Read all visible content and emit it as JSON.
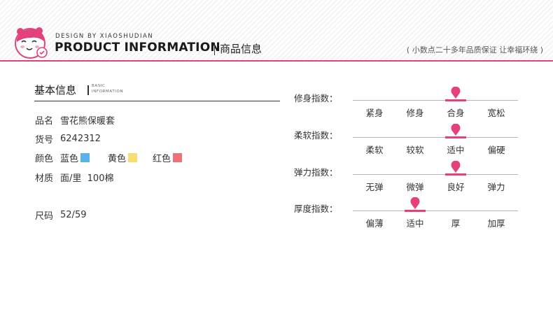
{
  "header": {
    "design_by": "DESIGN BY XIAOSHUDIAN",
    "title_en": "PRODUCT INFORMATION",
    "title_cn": "商品信息",
    "slogan": "( 小数点二十多年品质保证 让幸福环绕 )",
    "accent_color": "#e4407b"
  },
  "basic": {
    "title": "基本信息",
    "en_line1": "BASIC",
    "en_line2": "INFORMATION",
    "name": {
      "label": "品名",
      "value": "雪花熊保暖套"
    },
    "sku": {
      "label": "货号",
      "value": "6242312"
    },
    "colors": {
      "label": "颜色",
      "items": [
        {
          "name": "蓝色",
          "swatch": "#56b3ec"
        },
        {
          "name": "黄色",
          "swatch": "#f8dd72"
        },
        {
          "name": "红色",
          "swatch": "#ee7177"
        }
      ]
    },
    "material": {
      "label": "材质",
      "value": "面/里  100棉"
    },
    "size": {
      "label": "尺码",
      "value": "52/59"
    }
  },
  "indices": [
    {
      "label": "修身指数：",
      "options": [
        "紧身",
        "修身",
        "合身",
        "宽松"
      ],
      "selected": 2
    },
    {
      "label": "柔软指数：",
      "options": [
        "柔软",
        "较软",
        "适中",
        "偏硬"
      ],
      "selected": 2
    },
    {
      "label": "弹力指数：",
      "options": [
        "无弹",
        "微弹",
        "良好",
        "弹力"
      ],
      "selected": 2
    },
    {
      "label": "厚度指数：",
      "options": [
        "偏薄",
        "适中",
        "厚",
        "加厚"
      ],
      "selected": 1
    }
  ]
}
